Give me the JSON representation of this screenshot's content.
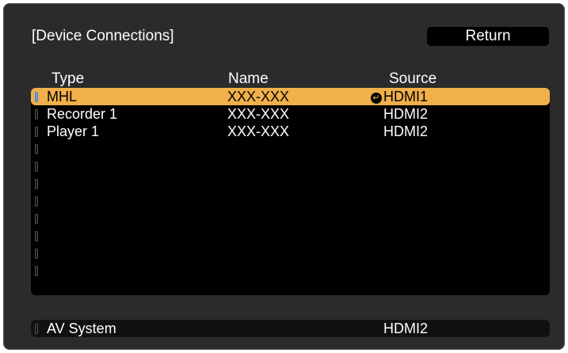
{
  "dialog": {
    "title": "[Device Connections]",
    "return_label": "Return"
  },
  "columns": {
    "type": "Type",
    "name": "Name",
    "source": "Source"
  },
  "devices": [
    {
      "type": "MHL",
      "name": "XXX-XXX",
      "source": "HDMI1",
      "selected": true,
      "source_icon": "active-source-icon"
    },
    {
      "type": "Recorder 1",
      "name": "XXX-XXX",
      "source": "HDMI2",
      "selected": false
    },
    {
      "type": "Player 1",
      "name": "XXX-XXX",
      "source": "HDMI2",
      "selected": false
    },
    {
      "type": "",
      "name": "",
      "source": ""
    },
    {
      "type": "",
      "name": "",
      "source": ""
    },
    {
      "type": "",
      "name": "",
      "source": ""
    },
    {
      "type": "",
      "name": "",
      "source": ""
    },
    {
      "type": "",
      "name": "",
      "source": ""
    },
    {
      "type": "",
      "name": "",
      "source": ""
    },
    {
      "type": "",
      "name": "",
      "source": ""
    },
    {
      "type": "",
      "name": "",
      "source": ""
    }
  ],
  "av_system": {
    "type": "AV System",
    "source": "HDMI2"
  },
  "colors": {
    "panel_background": "#2b2b2b",
    "list_background": "#000000",
    "selection_highlight": "#f2b04a",
    "text": "#ffffff"
  }
}
